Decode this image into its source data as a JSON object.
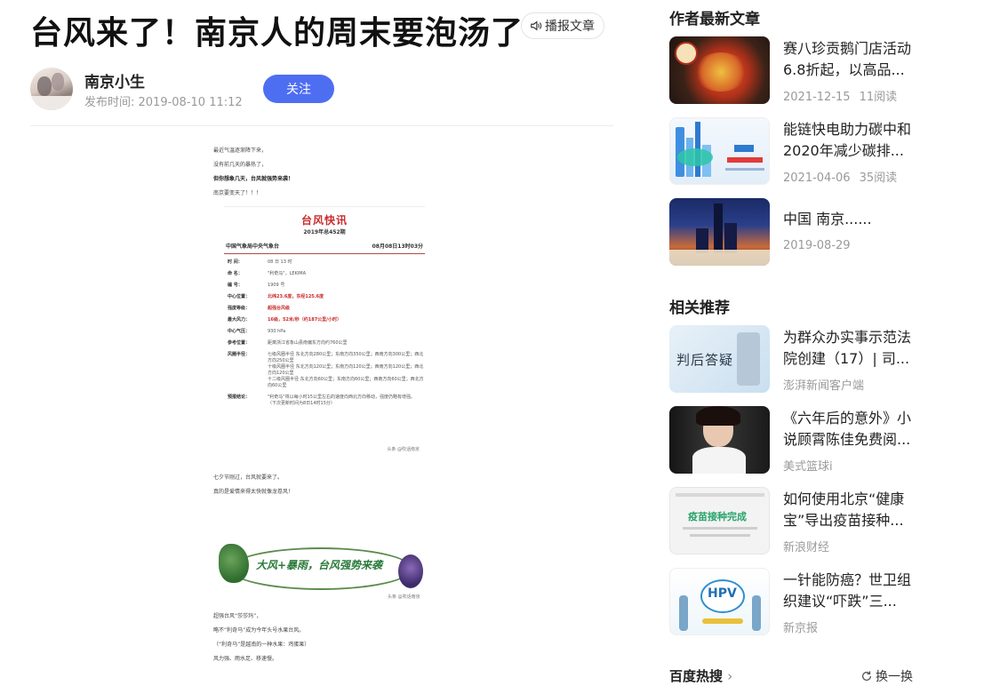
{
  "article": {
    "title": "台风来了！南京人的周末要泡汤了",
    "report_label": "播报文章",
    "author_name": "南京小生",
    "publish_time": "发布时间: 2019-08-10 11:12",
    "follow_label": "关注",
    "intro": [
      "最近气温逐渐降下来，",
      "没有前几天的暴热了，",
      "但你想象几天，台风就强势来袭！",
      "南京要变天了！！！"
    ],
    "bulletin": {
      "title": "台风快讯",
      "issue": "2019年总452期",
      "issuer": "中国气象局中央气象台",
      "time": "08月08日13时03分",
      "rows": [
        {
          "k": "时    间：",
          "v": "08 日 13 时",
          "red": false
        },
        {
          "k": "命    名：",
          "v": "\"利奇马\"，LEKIMA",
          "red": false
        },
        {
          "k": "编    号：",
          "v": "1909 号",
          "red": false
        },
        {
          "k": "中心位置：",
          "v": "北纬23.6度，东经125.6度",
          "red": true
        },
        {
          "k": "强度等级：",
          "v": "超强台风级",
          "red": true
        },
        {
          "k": "最大风力：",
          "v": "16级，52米/秒（约187公里/小时）",
          "red": true
        },
        {
          "k": "中心气压：",
          "v": "930 hPa",
          "red": false
        },
        {
          "k": "参考位置：",
          "v": "距离浙江省象山县南偏东方向约760公里",
          "red": false
        },
        {
          "k": "风圈半径：",
          "v": "七级风圈半径  东北方向280公里；东南方向350公里；西南方向300公里；西北方向250公里\n十级风圈半径  东北方向120公里；东南方向120公里；西南方向120公里；西北方向120公里\n十二级风圈半径  东北方向60公里；东南方向60公里；西南方向60公里；西北方向60公里",
          "red": false
        },
        {
          "k": "预报结论：",
          "v": "\"利奇马\"将以每小时15公里左右的速度向西北方向移动，强度仍略有增强。\n（下次更新时间为8日14时15分）",
          "red": false
        }
      ],
      "watermark": "头条 @吹话南京"
    },
    "outro": [
      "七夕节刚过，台风就要来了。",
      "真的是爱情来得太快就像龙卷风！"
    ],
    "banner_text": "大风+暴雨，台风强势来袭",
    "banner_watermark": "头条 @吹话南京",
    "story": [
      "超强台风“莎莎玛”，",
      "略不“利奇马”成为今年头号水果台风。",
      "（“利奇马”是越南的一种水果：鸡蛋果）",
      "风力强、雨水足、移速慢。"
    ]
  },
  "sidebar": {
    "latest_title": "作者最新文章",
    "latest": [
      {
        "title": "赛八珍贡鹅门店活动6.8折起，以高品...",
        "date": "2021-12-15",
        "reads": "11阅读"
      },
      {
        "title": "能链快电助力碳中和 2020年减少碳排...",
        "date": "2021-04-06",
        "reads": "35阅读"
      },
      {
        "title": "中国 南京......",
        "date": "2019-08-29",
        "reads": ""
      }
    ],
    "related_title": "相关推荐",
    "related": [
      {
        "title": "为群众办实事示范法院创建（17）| 司...",
        "source": "澎湃新闻客户端",
        "thumb_text": "判后答疑"
      },
      {
        "title": "《六年后的意外》小说顾霄陈佳免费阅...",
        "source": "美式篮球i",
        "thumb_text": ""
      },
      {
        "title": "如何使用北京“健康宝”导出疫苗接种...",
        "source": "新浪财经",
        "thumb_text": "疫苗接种完成"
      },
      {
        "title": "一针能防癌？世卫组织建议“吓跌”三...",
        "source": "新京报",
        "thumb_text": "HPV"
      }
    ],
    "hot_title": "百度热搜",
    "refresh_label": "换一换"
  },
  "colors": {
    "accent": "#4e6ef2",
    "bulletin_red": "#c92b2b"
  }
}
